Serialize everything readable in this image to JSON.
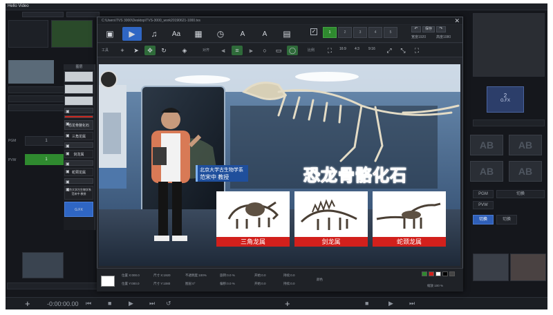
{
  "app": {
    "logo": "Hello Video",
    "bottom": {
      "timecode": "-0:00:00.00",
      "controls": [
        "⏮",
        "■",
        "▶",
        "⏭",
        "↺"
      ]
    }
  },
  "background": {
    "gfx_label": "2",
    "gfx_sub": "G.FX",
    "ab_label": "AB",
    "left_buttons": [
      {
        "label": "1"
      },
      {
        "label": "1"
      }
    ],
    "left_labels": [
      "PGM",
      "PVW"
    ],
    "right_buttons": [
      "PGM",
      "PVW",
      "切换"
    ],
    "right_labels": [
      "切换",
      "切换"
    ]
  },
  "dialog": {
    "path": "C:\\Users\\TVS 3000\\Desktop\\TVS-3000_work20190621-1000.tvs",
    "close": "✕",
    "toolbar": [
      {
        "name": "image-tool",
        "icon": "image-icon",
        "glyph": "▣"
      },
      {
        "name": "video-tool",
        "icon": "video-icon",
        "glyph": "▶"
      },
      {
        "name": "audio-tool",
        "icon": "music-icon",
        "glyph": "♫"
      },
      {
        "name": "text-tool",
        "icon": "text-icon",
        "glyph": "Aa"
      },
      {
        "name": "calendar-tool",
        "icon": "calendar-icon",
        "glyph": "▦"
      },
      {
        "name": "clock-tool",
        "icon": "clock-icon",
        "glyph": "◷"
      },
      {
        "name": "caption-tool",
        "icon": "caption-icon",
        "glyph": "A"
      },
      {
        "name": "shape-tool",
        "icon": "shape-icon",
        "glyph": "A"
      },
      {
        "name": "media-tool",
        "icon": "media-icon",
        "glyph": "▤"
      }
    ],
    "pages": [
      "1",
      "2",
      "3",
      "4",
      "5",
      "6"
    ],
    "top_right": {
      "undo": "↶",
      "redo": "↷",
      "save": "保存",
      "label1": "宽度1920",
      "label2": "高度1080"
    },
    "row2": {
      "label_tools": "工具",
      "label_align": "对齐",
      "label_ratio": "比例",
      "ratios": [
        "16:9",
        "4:3",
        "9:16"
      ]
    }
  },
  "layers": {
    "title": "图层",
    "items": [
      {
        "kind": "thumb",
        "label": ""
      },
      {
        "kind": "thumb",
        "label": ""
      },
      {
        "kind": "thumb",
        "label": ""
      },
      {
        "kind": "img",
        "label": ""
      },
      {
        "kind": "red",
        "label": ""
      },
      {
        "kind": "img",
        "label": "恐龙骨骼化石"
      },
      {
        "kind": "text",
        "label": "三角龙属"
      },
      {
        "kind": "img",
        "label": ""
      },
      {
        "kind": "text",
        "label": "剑龙属"
      },
      {
        "kind": "img",
        "label": ""
      },
      {
        "kind": "text",
        "label": "蛇颈龙属"
      },
      {
        "kind": "img",
        "label": ""
      },
      {
        "kind": "text",
        "label": "北京大学古生物学系 范宋中 教授"
      },
      {
        "kind": "sel",
        "label": "G.FX"
      }
    ]
  },
  "canvas": {
    "headline": "恐龙骨骼化石",
    "caption_line1": "北京大学古生物学系",
    "caption_line2": "范宋中 教授",
    "cards": [
      {
        "label": "三角龙属",
        "icon": "triceratops-skeleton-icon"
      },
      {
        "label": "剑龙属",
        "icon": "stegosaurus-skeleton-icon"
      },
      {
        "label": "蛇颈龙属",
        "icon": "plesiosaur-skeleton-icon"
      }
    ],
    "colors": {
      "accent_red": "#d2201c",
      "caption_blue": "#1f4f9c",
      "wall_blue": "#3f6390"
    }
  },
  "props": {
    "fields": [
      "位置 X:000.0",
      "尺寸 X:1920",
      "不透明度:100%",
      "旋转:0.0 %",
      "开始:0.0",
      "持续:0.0",
      "位置 Y:000.0",
      "尺寸 Y:1080",
      "图层:0°",
      "偏移:0.0 %",
      "开始:0.0",
      "持续:0.0"
    ],
    "misc_label": "颜色",
    "zoom": "缩放 100 %"
  }
}
